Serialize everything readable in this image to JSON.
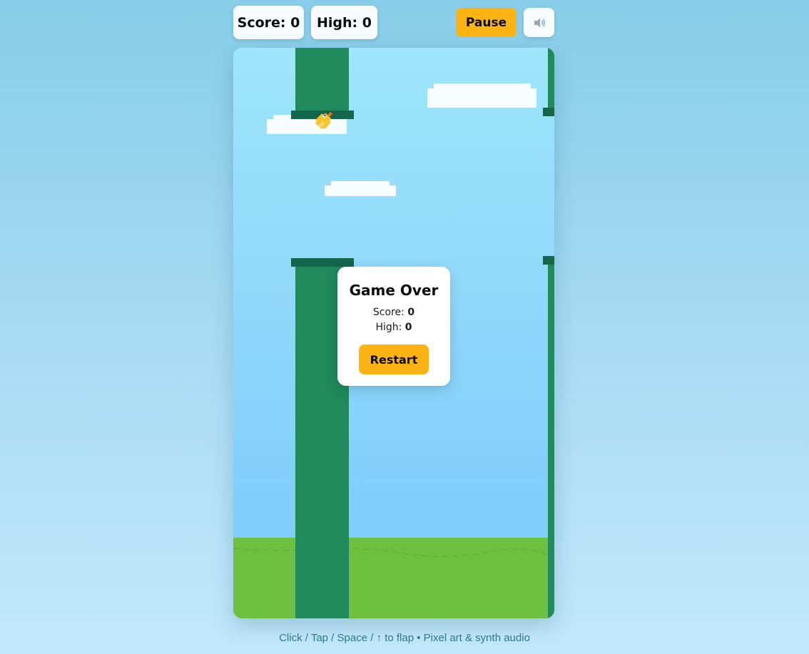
{
  "hud": {
    "score_label": "Score:",
    "score_value": "0",
    "high_label": "High:",
    "high_value": "0",
    "pause_label": "Pause",
    "sound_icon": "speaker-icon"
  },
  "game_over": {
    "title": "Game Over",
    "score_label": "Score:",
    "score_value": "0",
    "high_label": "High:",
    "high_value": "0",
    "restart_label": "Restart"
  },
  "footer": {
    "hint": "Click / Tap / Space / ↑ to flap • Pixel art & synth audio"
  },
  "colors": {
    "accent": "#fdb412",
    "pipe": "#208a5c",
    "pipe_cap": "#14674a",
    "ground": "#6dbf3f",
    "sky_top": "#9de6fc",
    "sky_bottom": "#77c9fb"
  }
}
